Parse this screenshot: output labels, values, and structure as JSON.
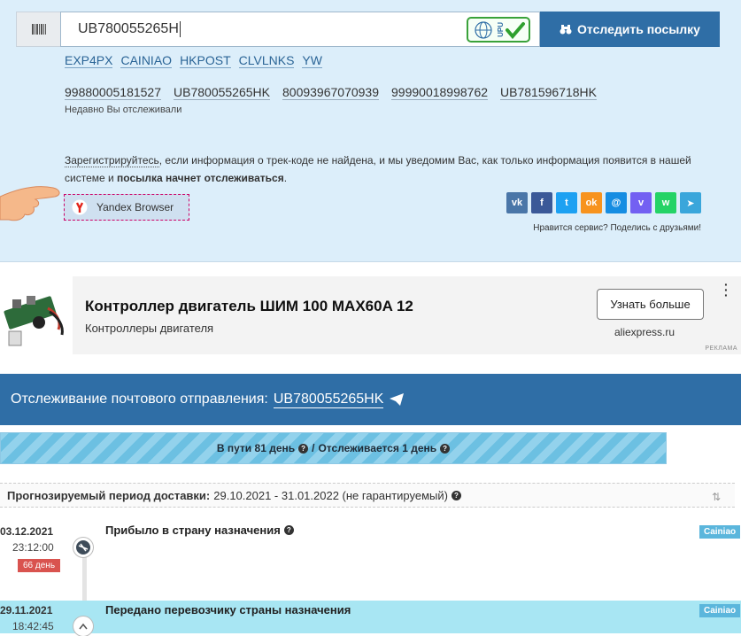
{
  "search": {
    "value": "UB780055265H",
    "upu_badge": "UPU",
    "track_button": "Отследить посылку"
  },
  "carriers": [
    "EXP4PX",
    "CAINIAO",
    "HKPOST",
    "CLVLNKS",
    "YW"
  ],
  "recent": {
    "items": [
      "99880005181527",
      "UB780055265HK",
      "80093967070939",
      "99990018998762",
      "UB781596718HK"
    ],
    "label": "Недавно Вы отслеживали"
  },
  "register": {
    "link": "Зарегистрируйтесь",
    "text1": ", если информация о трек-коде не найдена, и мы уведомим Вас, как только информация появится в нашей системе и ",
    "bold": "посылка начнет отслеживаться",
    "text2": "."
  },
  "yandex": {
    "label": "Yandex Browser"
  },
  "social": {
    "icons": [
      "vk-icon",
      "facebook-icon",
      "twitter-icon",
      "odnoklassniki-icon",
      "moimir-icon",
      "viber-icon",
      "whatsapp-icon",
      "telegram-icon"
    ],
    "note": "Нравится сервис? Поделись с друзьями!"
  },
  "ad": {
    "title": "Контроллер двигатель ШИМ 100 MAX60A 12",
    "subtitle": "Контроллеры двигателя",
    "button": "Узнать больше",
    "domain": "aliexpress.ru",
    "label": "РЕКЛАМА"
  },
  "tracking": {
    "heading": "Отслеживание почтового отправления:",
    "number": "UB780055265HK",
    "progress": "В пути 81 день",
    "progress_sep": "/",
    "tracked": "Отслеживается 1 день",
    "forecast_label": "Прогнозируемый период доставки:",
    "forecast_value": "29.10.2021 - 31.01.2022 (не гарантируемый)"
  },
  "events": [
    {
      "date": "03.12.2021",
      "time": "23:12:00",
      "badge": "66 день",
      "title": "Прибыло в страну назначения",
      "carrier": "Cainiao"
    },
    {
      "date": "29.11.2021",
      "time": "18:42:45",
      "title": "Передано перевозчику страны назначения",
      "carrier": "Cainiao"
    }
  ],
  "colors": {
    "brand": "#2f6ea6",
    "topbg": "#dceefa",
    "highlight": "#a8e6f3"
  }
}
